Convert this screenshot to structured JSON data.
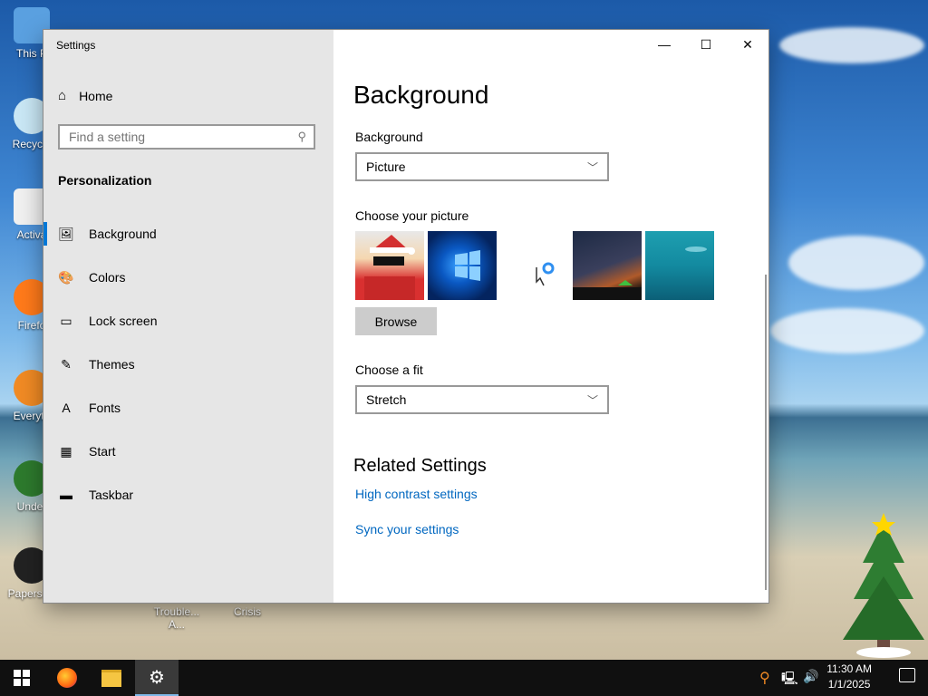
{
  "desktop": {
    "icons": [
      {
        "label": "This P",
        "x": "left"
      },
      {
        "label": "Recycle",
        "x": "left"
      },
      {
        "label": "Activa",
        "x": "left"
      },
      {
        "label": "Firefo",
        "x": "left"
      },
      {
        "label": "Everyth",
        "x": "left"
      },
      {
        "label": "Under",
        "x": "left"
      },
      {
        "label": "Papers, P",
        "x": "left"
      }
    ],
    "bottom_labels": [
      "Trouble... A...",
      "Crisis"
    ]
  },
  "window": {
    "title": "Settings",
    "controls": {
      "minimize": "—",
      "maximize": "☐",
      "close": "✕"
    }
  },
  "nav": {
    "home_label": "Home",
    "search_placeholder": "Find a setting",
    "section": "Personalization",
    "items": [
      {
        "label": "Background",
        "icon": "🖼"
      },
      {
        "label": "Colors",
        "icon": "🎨"
      },
      {
        "label": "Lock screen",
        "icon": "▭"
      },
      {
        "label": "Themes",
        "icon": "✎"
      },
      {
        "label": "Fonts",
        "icon": "A"
      },
      {
        "label": "Start",
        "icon": "▦"
      },
      {
        "label": "Taskbar",
        "icon": "▬"
      }
    ]
  },
  "main": {
    "title": "Background",
    "background_label": "Background",
    "background_value": "Picture",
    "choose_picture_label": "Choose your picture",
    "browse_label": "Browse",
    "fit_label": "Choose a fit",
    "fit_value": "Stretch",
    "related_title": "Related Settings",
    "links": [
      "High contrast settings",
      "Sync your settings"
    ]
  },
  "taskbar": {
    "time": "11:30 AM",
    "date": "1/1/2025"
  },
  "colors": {
    "accent": "#0078d7",
    "link": "#0067c0",
    "nav_bg": "#e6e6e6"
  }
}
